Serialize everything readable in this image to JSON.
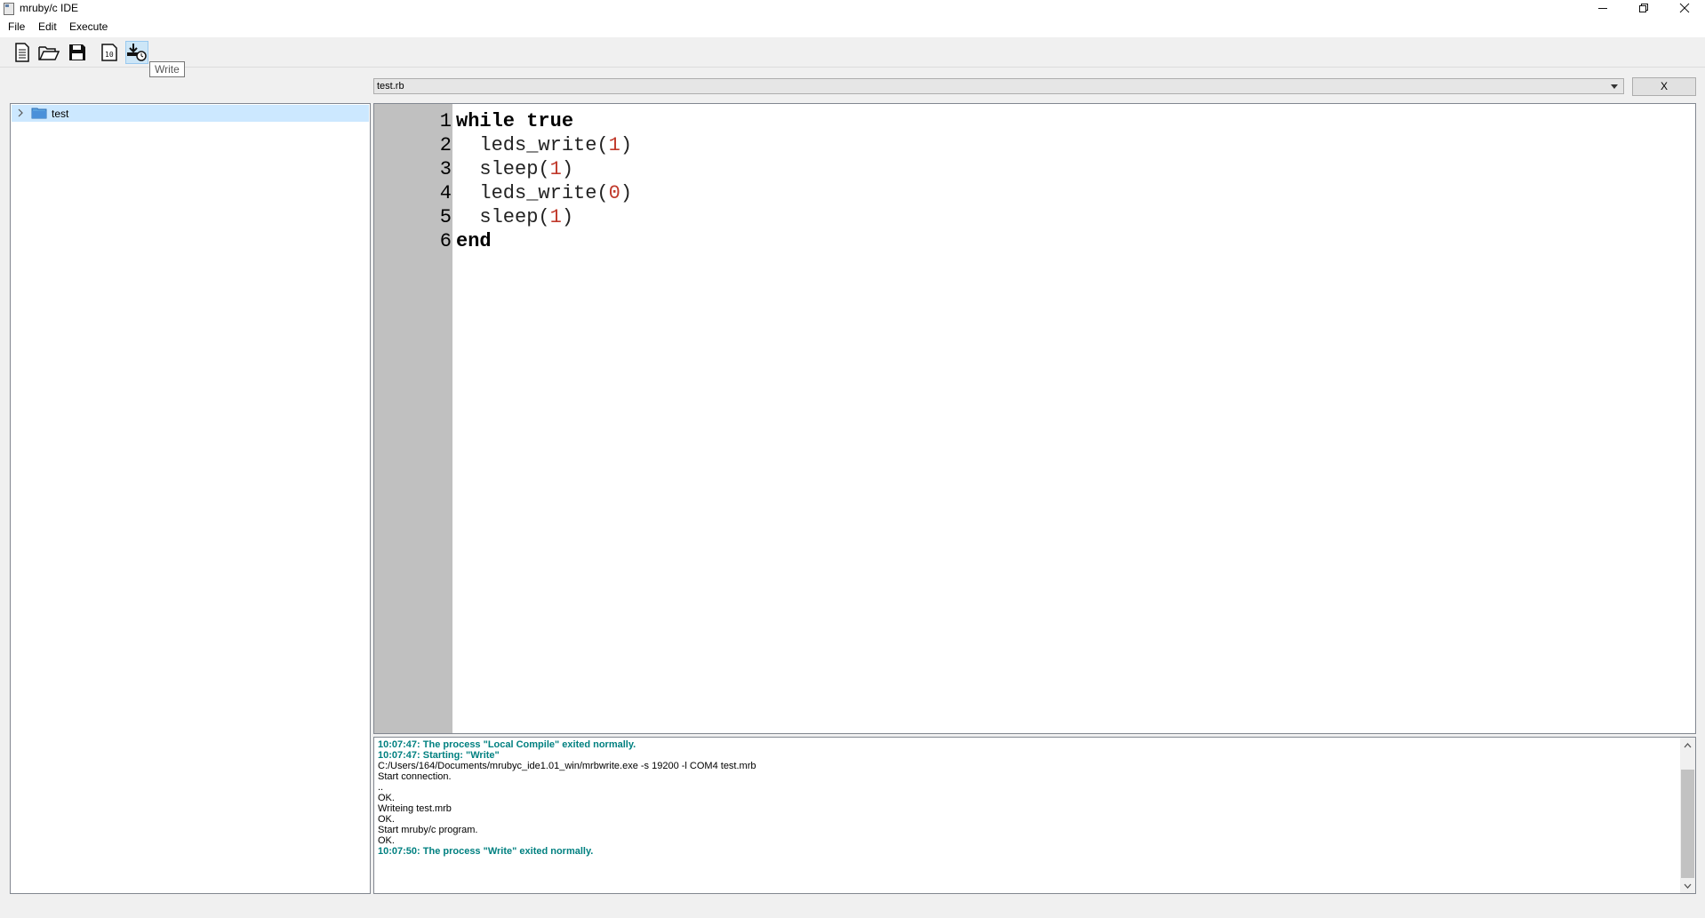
{
  "window": {
    "title": "mruby/c IDE"
  },
  "menu": {
    "items": [
      "File",
      "Edit",
      "Execute"
    ]
  },
  "toolbar": {
    "buttons": [
      {
        "icon": "new-file-icon"
      },
      {
        "icon": "open-folder-icon"
      },
      {
        "icon": "save-icon"
      },
      {
        "icon": "compile-icon"
      },
      {
        "icon": "write-icon"
      }
    ],
    "tooltip": "Write"
  },
  "file_selector": {
    "value": "test.rb",
    "close_label": "X"
  },
  "project_tree": {
    "items": [
      {
        "label": "test",
        "icon": "folder-icon",
        "selected": true
      }
    ]
  },
  "editor": {
    "lines": [
      {
        "no": "1",
        "parts": [
          {
            "t": "while true",
            "c": "kw"
          }
        ]
      },
      {
        "no": "2",
        "parts": [
          {
            "t": "  leds_write(",
            "c": "plain"
          },
          {
            "t": "1",
            "c": "num"
          },
          {
            "t": ")",
            "c": "plain"
          }
        ]
      },
      {
        "no": "3",
        "parts": [
          {
            "t": "  sleep(",
            "c": "plain"
          },
          {
            "t": "1",
            "c": "num"
          },
          {
            "t": ")",
            "c": "plain"
          }
        ]
      },
      {
        "no": "4",
        "parts": [
          {
            "t": "  leds_write(",
            "c": "plain"
          },
          {
            "t": "0",
            "c": "num"
          },
          {
            "t": ")",
            "c": "plain"
          }
        ]
      },
      {
        "no": "5",
        "parts": [
          {
            "t": "  sleep(",
            "c": "plain"
          },
          {
            "t": "1",
            "c": "num"
          },
          {
            "t": ")",
            "c": "plain"
          }
        ]
      },
      {
        "no": "6",
        "parts": [
          {
            "t": "end",
            "c": "kw"
          }
        ]
      }
    ]
  },
  "output": {
    "lines": [
      {
        "text": "10:07:47: The process \"Local Compile\" exited normally.",
        "style": "status"
      },
      {
        "text": "10:07:47: Starting: \"Write\"",
        "style": "status"
      },
      {
        "text": "C:/Users/164/Documents/mrubyc_ide1.01_win/mrbwrite.exe -s 19200 -l COM4 test.mrb",
        "style": "plain"
      },
      {
        "text": "Start connection.",
        "style": "plain"
      },
      {
        "text": "..",
        "style": "plain"
      },
      {
        "text": "OK.",
        "style": "plain"
      },
      {
        "text": "Writeing test.mrb",
        "style": "plain"
      },
      {
        "text": "OK.",
        "style": "plain"
      },
      {
        "text": "Start mruby/c program.",
        "style": "plain"
      },
      {
        "text": "OK.",
        "style": "plain"
      },
      {
        "text": "10:07:50: The process \"Write\" exited normally.",
        "style": "status"
      }
    ]
  }
}
